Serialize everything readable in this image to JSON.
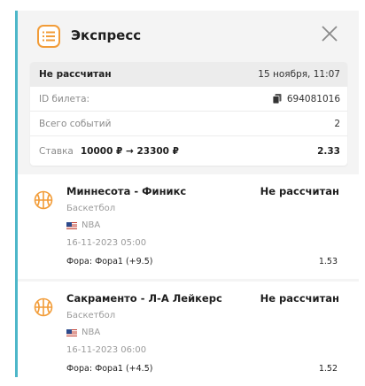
{
  "header": {
    "title": "Экспресс"
  },
  "icons": {
    "app": "list-icon",
    "close": "close-icon",
    "ticket": "ticket-icon",
    "sport": "basketball-icon",
    "flag": "us-flag-icon"
  },
  "colors": {
    "accent": "#4db7c9",
    "icon": "#f29c38"
  },
  "summary": {
    "status": "Не рассчитан",
    "date": "15 ноября, 11:07",
    "ticket_label": "ID билета:",
    "ticket_id": "694081016",
    "events_label": "Всего событий",
    "events_count": "2",
    "stake_label": "Ставка",
    "stake_value": "10000 ₽ → 23300 ₽",
    "total_odds": "2.33"
  },
  "events": [
    {
      "teams": "Миннесота - Финикс",
      "status": "Не рассчитан",
      "sport": "Баскетбол",
      "league": "NBA",
      "date": "16-11-2023 05:00",
      "bet": "Фора: Фора1 (+9.5)",
      "odds": "1.53"
    },
    {
      "teams": "Сакраменто - Л-А Лейкерс",
      "status": "Не рассчитан",
      "sport": "Баскетбол",
      "league": "NBA",
      "date": "16-11-2023 06:00",
      "bet": "Фора: Фора1 (+4.5)",
      "odds": "1.52"
    }
  ]
}
